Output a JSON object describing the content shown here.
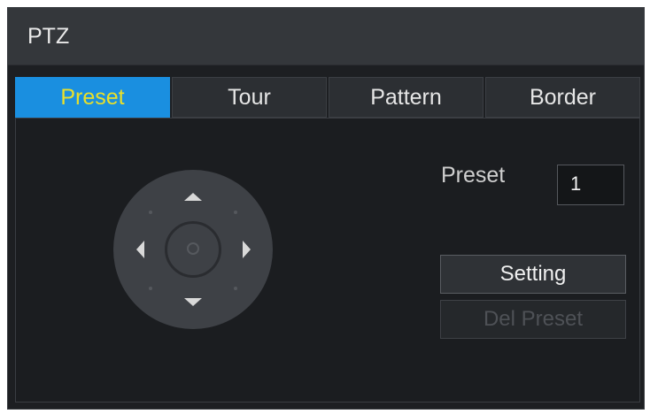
{
  "window": {
    "title": "PTZ"
  },
  "tabs": [
    {
      "label": "Preset",
      "active": true
    },
    {
      "label": "Tour",
      "active": false
    },
    {
      "label": "Pattern",
      "active": false
    },
    {
      "label": "Border",
      "active": false
    }
  ],
  "dpad": {
    "icons": [
      "arrow-up-icon",
      "arrow-down-icon",
      "arrow-left-icon",
      "arrow-right-icon",
      "zoom-icon"
    ]
  },
  "preset": {
    "label": "Preset",
    "value": "1"
  },
  "buttons": {
    "setting_label": "Setting",
    "delete_label": "Del Preset"
  },
  "colors": {
    "accent": "#1a8fe0",
    "active_tab_text": "#e9e02a",
    "background": "#1d1f22"
  }
}
